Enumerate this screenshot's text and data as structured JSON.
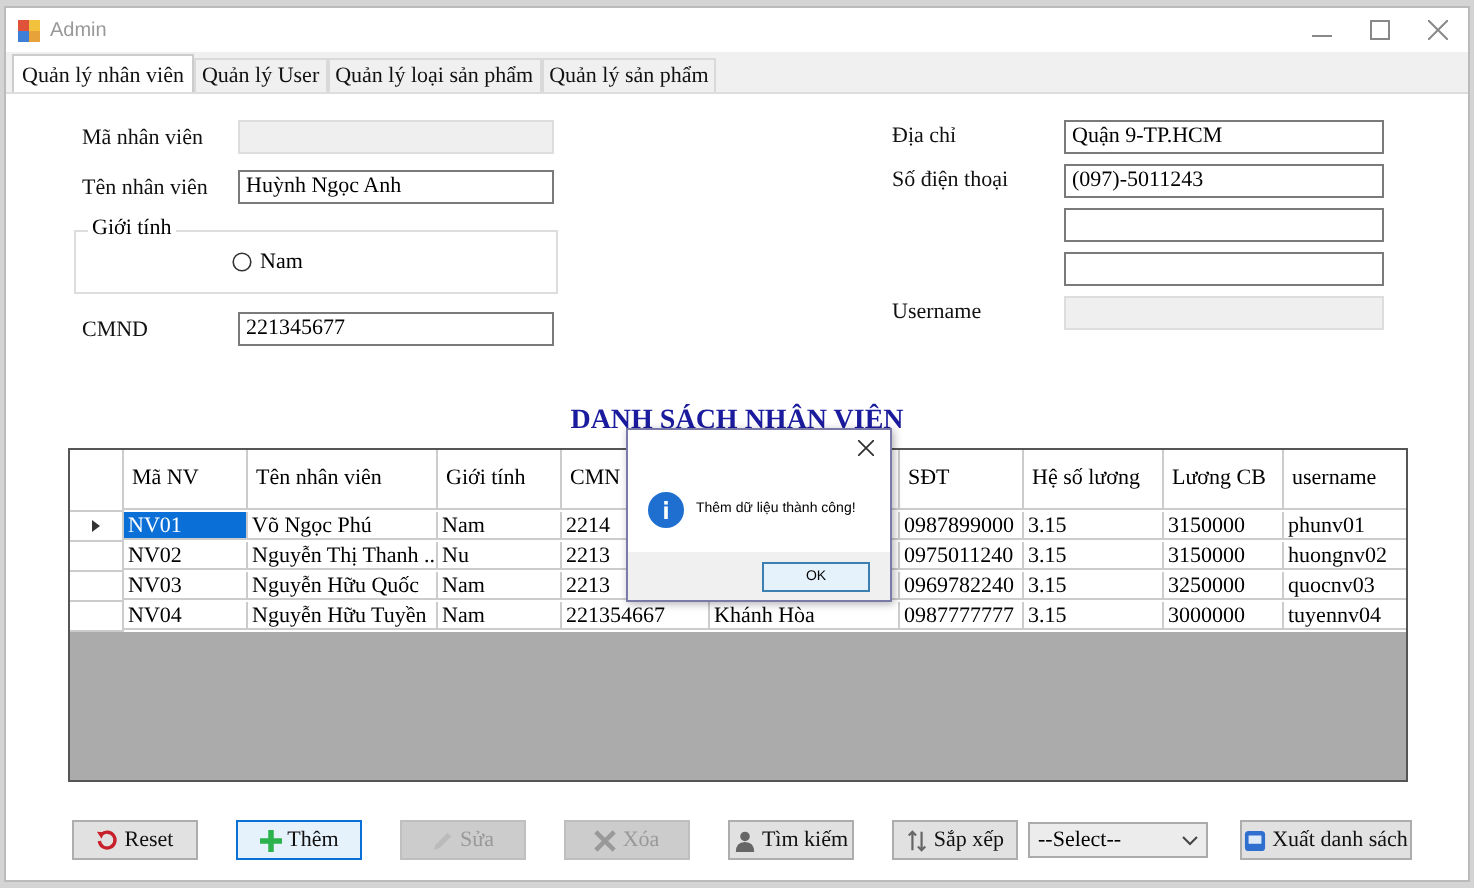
{
  "window": {
    "title": "Admin"
  },
  "tabs": [
    {
      "label": "Quản lý nhân viên",
      "selected": true
    },
    {
      "label": "Quản lý User",
      "selected": false
    },
    {
      "label": "Quản lý loại sản phẩm",
      "selected": false
    },
    {
      "label": "Quản lý sản phẩm",
      "selected": false
    }
  ],
  "form_left": [
    {
      "kind": "field",
      "label": "Mã nhân viên",
      "disabled": true
    },
    {
      "kind": "field",
      "label": "Tên nhân viên",
      "value": "Huỳnh Ngọc Anh",
      "disabled": false
    },
    {
      "kind": "group",
      "label": "Giới tính",
      "options": [
        {
          "label": "Nam",
          "selected": false
        }
      ]
    },
    {
      "kind": "field",
      "label": "CMND",
      "value": "221345677",
      "disabled": false
    }
  ],
  "form_right": [
    {
      "label": "Địa chỉ",
      "value": "Quận 9-TP.HCM",
      "disabled": false
    },
    {
      "label": "Số điện thoại",
      "value": "(097)-5011243",
      "disabled": false
    },
    {
      "disabled": false
    },
    {
      "disabled": false
    },
    {
      "label": "Username",
      "disabled": true
    }
  ],
  "list_title": "DANH SÁCH NHÂN VIÊN",
  "table": {
    "columns": [
      {
        "header": "Mã NV"
      },
      {
        "header": "Tên nhân viên"
      },
      {
        "header": "Giới tính"
      },
      {
        "header": "CMN"
      },
      {},
      {
        "header": "SĐT"
      },
      {
        "header": "Hệ số lương"
      },
      {
        "header": "Lương CB"
      },
      {
        "header": "username"
      }
    ],
    "rows": [
      {
        "selected": true,
        "cells": [
          "NV01",
          "Võ Ngọc Phú",
          "Nam",
          "2214",
          null,
          "0987899000",
          "3.15",
          "3150000",
          "phunv01"
        ]
      },
      {
        "selected": false,
        "cells": [
          "NV02",
          "Nguyễn Thị Thanh ...",
          "Nu",
          "2213",
          null,
          "0975011240",
          "3.15",
          "3150000",
          "huongnv02"
        ]
      },
      {
        "selected": false,
        "cells": [
          "NV03",
          "Nguyễn Hữu Quốc",
          "Nam",
          "2213",
          null,
          "0969782240",
          "3.15",
          "3250000",
          "quocnv03"
        ]
      },
      {
        "selected": false,
        "cells": [
          "NV04",
          "Nguyễn Hữu Tuyền",
          "Nam",
          "221354667",
          "Khánh Hòa",
          "0987777777",
          "3.15",
          "3000000",
          "tuyennv04"
        ]
      }
    ]
  },
  "dialog": {
    "message": "Thêm dữ liệu thành công!",
    "button": "OK"
  },
  "toolbar": [
    {
      "kind": "reset",
      "label": "Reset",
      "disabled": false,
      "focused": false
    },
    {
      "kind": "add",
      "label": "Thêm",
      "disabled": false,
      "focused": true
    },
    {
      "kind": "edit",
      "label": "Sửa",
      "disabled": true,
      "focused": false
    },
    {
      "kind": "delete",
      "label": "Xóa",
      "disabled": true,
      "focused": false
    },
    {
      "kind": "search",
      "label": "Tìm kiếm",
      "disabled": false,
      "focused": false
    },
    {
      "kind": "sort",
      "label": "Sắp xếp",
      "disabled": false,
      "focused": false
    },
    {
      "kind": "select",
      "value": "--Select--"
    },
    {
      "kind": "export",
      "label": "Xuất danh sách",
      "disabled": false,
      "focused": false
    }
  ]
}
